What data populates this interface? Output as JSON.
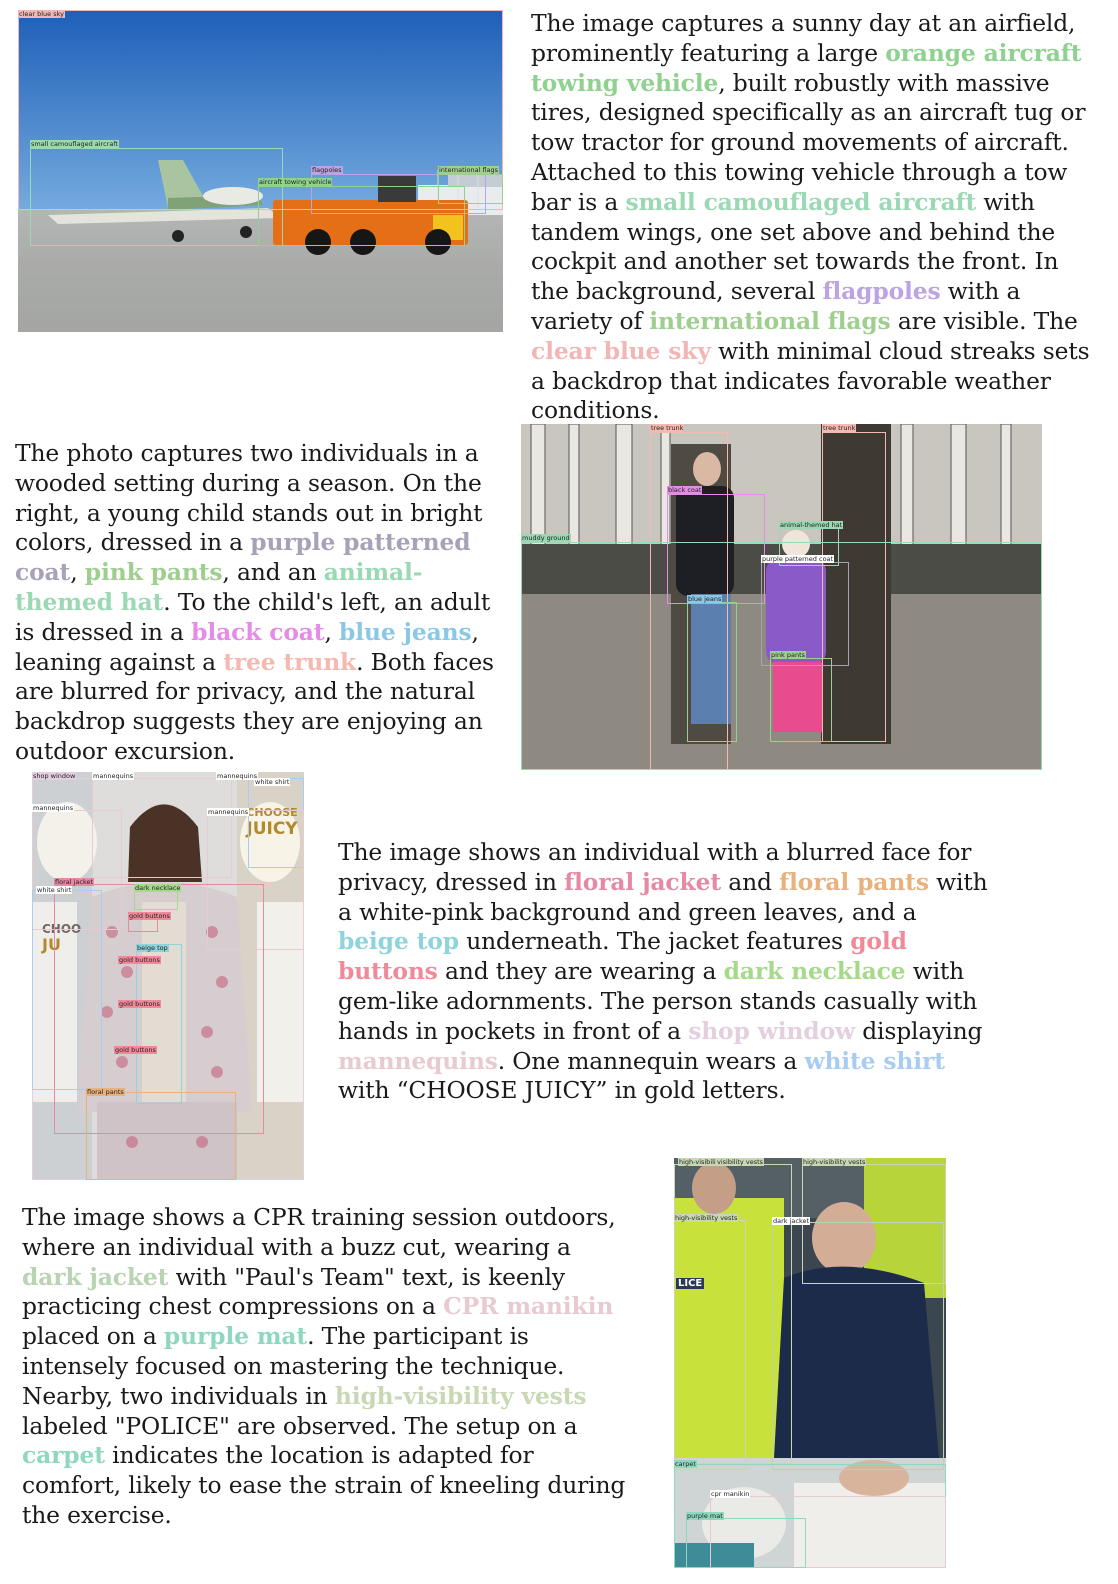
{
  "colors": {
    "green": "#8fd18f",
    "mint": "#9ad9b4",
    "lavender": "#bda3e3",
    "pink_sky": "#f2b6b6",
    "gray_purple": "#a9a1b8",
    "olive_green": "#9fcf8f",
    "magenta": "#e48ce6",
    "blue": "#8cc7e6",
    "salmon": "#f4b9b0",
    "rose": "#e68aa4",
    "tan": "#e8b27e",
    "teal": "#8fd3dc",
    "gold_pink": "#f08a9a",
    "light_green": "#a6d98a",
    "pale_mauve": "#e4cfe0",
    "sky_blue": "#a9cdf2",
    "sage": "#b9d4b2",
    "pale_pink": "#e8cbd0",
    "seafoam": "#8fd8bf",
    "khaki": "#c8d8b4"
  },
  "panels": [
    {
      "id": "airfield",
      "segments": [
        {
          "t": "The image captures a sunny day at an airfield, prominently featuring a large "
        },
        {
          "t": "orange aircraft towing vehicle",
          "c": "green"
        },
        {
          "t": ", built robustly with massive tires, designed specifically as an aircraft tug or tow tractor for ground movements of aircraft. Attached to this towing vehicle through a tow bar is a "
        },
        {
          "t": "small camouflaged aircraft",
          "c": "mint"
        },
        {
          "t": " with tandem wings, one set above and behind the cockpit and another set towards the front. In the background, several "
        },
        {
          "t": "flagpoles",
          "c": "lavender"
        },
        {
          "t": " with a variety of "
        },
        {
          "t": "international flags",
          "c": "olive_green"
        },
        {
          "t": " are visible. The "
        },
        {
          "t": "clear blue sky",
          "c": "pink_sky"
        },
        {
          "t": " with minimal cloud streaks sets a backdrop that indicates favorable weather conditions."
        }
      ],
      "tags": [
        "clear blue sky",
        "small camouflaged aircraft",
        "flagpoles",
        "international flags",
        "aircraft towing vehicle"
      ]
    },
    {
      "id": "woods",
      "segments": [
        {
          "t": "The photo captures two individuals in a wooded setting during a season. On the right, a young child stands out in bright colors, dressed in a "
        },
        {
          "t": "purple patterned coat",
          "c": "gray_purple"
        },
        {
          "t": ", "
        },
        {
          "t": "pink pants",
          "c": "olive_green"
        },
        {
          "t": ", and an "
        },
        {
          "t": "animal-themed hat",
          "c": "mint"
        },
        {
          "t": ". To the child's left, an adult is dressed in a "
        },
        {
          "t": "black coat",
          "c": "magenta"
        },
        {
          "t": ", "
        },
        {
          "t": "blue jeans",
          "c": "blue"
        },
        {
          "t": ", leaning against a "
        },
        {
          "t": "tree trunk",
          "c": "salmon"
        },
        {
          "t": ". Both faces are blurred for privacy, and the natural backdrop suggests they are enjoying an outdoor excursion."
        }
      ],
      "tags": [
        "tree trunk",
        "tree trunk",
        "black coat",
        "animal-themed hat",
        "muddy ground",
        "purple patterned coat",
        "blue jeans",
        "pink pants"
      ]
    },
    {
      "id": "floral",
      "segments": [
        {
          "t": "The image shows an individual with a blurred face for privacy, dressed in "
        },
        {
          "t": "floral jacket",
          "c": "rose"
        },
        {
          "t": " and "
        },
        {
          "t": "floral pants",
          "c": "tan"
        },
        {
          "t": " with a white-pink background and green leaves, and a "
        },
        {
          "t": "beige top",
          "c": "teal"
        },
        {
          "t": " underneath. The jacket features "
        },
        {
          "t": "gold buttons",
          "c": "gold_pink"
        },
        {
          "t": " and they are wearing a "
        },
        {
          "t": "dark necklace",
          "c": "light_green"
        },
        {
          "t": " with gem-like adornments. The person stands casually with hands in pockets in front of a "
        },
        {
          "t": "shop window",
          "c": "pale_mauve"
        },
        {
          "t": " displaying "
        },
        {
          "t": "mannequins",
          "c": "pale_pink"
        },
        {
          "t": ". One mannequin wears a "
        },
        {
          "t": "white shirt",
          "c": "sky_blue"
        },
        {
          "t": " with “CHOOSE JUICY” in gold letters."
        }
      ],
      "tags": [
        "shop window",
        "mannequins",
        "mannequins",
        "white shirt",
        "mannequins",
        "mannequins",
        "floral jacket",
        "white shirt",
        "dark necklace",
        "gold buttons",
        "beige top",
        "gold buttons",
        "gold buttons",
        "gold buttons",
        "floral pants"
      ],
      "signage": [
        "CHOOSE",
        "JUICY",
        "CHOO",
        "JU"
      ]
    },
    {
      "id": "cpr",
      "segments": [
        {
          "t": "The image shows a CPR training session outdoors, where an individual with a buzz cut, wearing a "
        },
        {
          "t": "dark jacket",
          "c": "sage"
        },
        {
          "t": " with \"Paul's Team\" text, is keenly practicing chest compressions on a "
        },
        {
          "t": "CPR manikin",
          "c": "pale_pink"
        },
        {
          "t": " placed on a "
        },
        {
          "t": "purple mat",
          "c": "seafoam"
        },
        {
          "t": ". The participant is intensely focused on mastering the technique. Nearby, two individuals in "
        },
        {
          "t": "high-visibility vests",
          "c": "khaki"
        },
        {
          "t": " labeled \"POLICE\" are observed. The setup on a "
        },
        {
          "t": "carpet",
          "c": "seafoam"
        },
        {
          "t": " indicates the location is adapted for comfort, likely to ease the strain of kneeling during the exercise."
        }
      ],
      "tags": [
        "high-visibility vests",
        "visibility vests",
        "high-visibility vests",
        "high-visibility vests",
        "dark jacket",
        "carpet",
        "cpr manikin",
        "purple mat"
      ],
      "signage": [
        "LICE"
      ]
    }
  ]
}
